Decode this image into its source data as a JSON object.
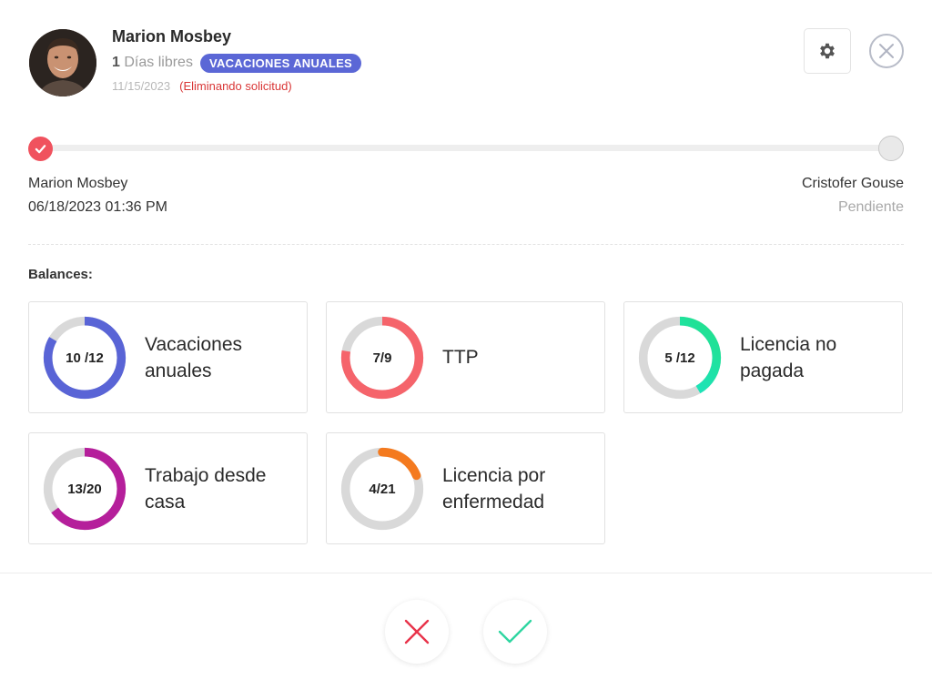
{
  "request": {
    "employee_name": "Marion Mosbey",
    "days_count": "1",
    "days_label": "Días libres",
    "leave_type": "VACACIONES ANUALES",
    "date": "11/15/2023",
    "status_note": "(Eliminando solicitud)"
  },
  "approval": {
    "start": {
      "name": "Marion Mosbey",
      "detail": "06/18/2023 01:36 PM",
      "done": true
    },
    "end": {
      "name": "Cristofer Gouse",
      "detail": "Pendiente",
      "done": false
    }
  },
  "balances_title": "Balances:",
  "balances": [
    {
      "label": "Vacaciones anuales",
      "ratio": "10 /12",
      "used": 10,
      "total": 12,
      "color": "#5964d6"
    },
    {
      "label": "TTP",
      "ratio": "7/9",
      "used": 7,
      "total": 9,
      "color": "#f5646b"
    },
    {
      "label": "Licencia no pagada",
      "ratio": "5 /12",
      "used": 5,
      "total": 12,
      "color": "#19e0d0"
    },
    {
      "label": "Trabajo desde casa",
      "ratio": "13/20",
      "used": 13,
      "total": 20,
      "color": "#b51f9b"
    },
    {
      "label": "Licencia por enfermedad",
      "ratio": "4/21",
      "used": 4,
      "total": 21,
      "color": "#f47a1f"
    }
  ],
  "colors": {
    "badge": "#5b67d6",
    "accent_red": "#f0525e",
    "reject": "#e8334a",
    "approve": "#2fd6a1"
  },
  "icons": {
    "settings": "gear-icon",
    "close": "close-icon",
    "reject": "reject-x-icon",
    "approve": "approve-check-icon"
  }
}
